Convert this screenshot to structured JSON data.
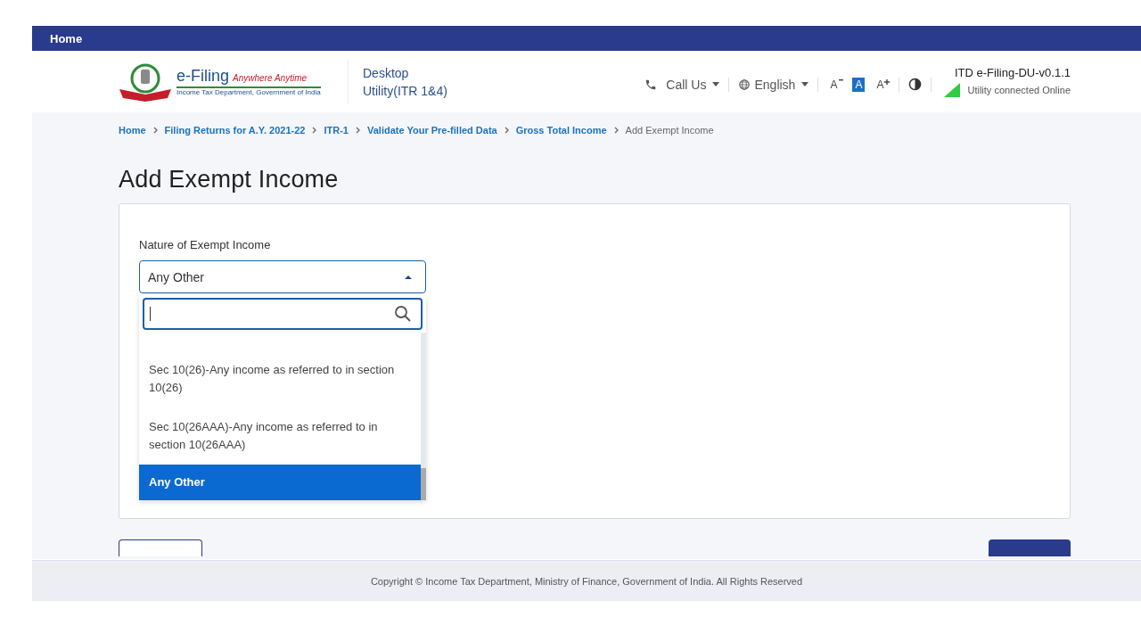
{
  "top_bar": {
    "home_link": "Home"
  },
  "header": {
    "logo": {
      "title": "e-Filing",
      "tagline": "Anywhere Anytime",
      "subtitle": "Income Tax Department, Government of India"
    },
    "app_name": [
      "Desktop",
      "Utility(ITR 1&4)"
    ],
    "call_us": "Call Us",
    "language": "English",
    "font_sizes": [
      {
        "label": "A",
        "kind": "decrease",
        "selected": false
      },
      {
        "label": "A",
        "kind": "normal",
        "selected": true
      },
      {
        "label": "A",
        "kind": "increase",
        "selected": false
      }
    ],
    "version": "ITD e-Filing-DU-v0.1.1",
    "status": "Utility connected Online"
  },
  "breadcrumb": [
    {
      "label": "Home",
      "link": true
    },
    {
      "label": "Filing Returns for A.Y. 2021-22",
      "link": true
    },
    {
      "label": "ITR-1",
      "link": true
    },
    {
      "label": "Validate Your Pre-filled Data",
      "link": true
    },
    {
      "label": "Gross Total Income",
      "link": true
    },
    {
      "label": "Add Exempt Income",
      "link": false
    }
  ],
  "page_title": "Add Exempt Income",
  "form": {
    "field_label": "Nature of Exempt Income",
    "value": "Any Other",
    "expanded": true,
    "options": [
      {
        "label": "Sec 10(26)-Any income as referred to in section 10(26)",
        "selected": false
      },
      {
        "label": "Sec 10(26AAA)-Any income as referred to in section 10(26AAA)",
        "selected": false
      },
      {
        "label": "Any Other",
        "selected": true
      }
    ]
  },
  "footer": {
    "copyright": "Copyright © Income Tax Department, Ministry of Finance, Government of India. All Rights Reserved"
  }
}
